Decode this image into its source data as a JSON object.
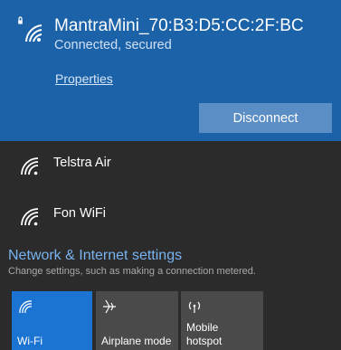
{
  "connected": {
    "name": "MantraMini_70:B3:D5:CC:2F:BC",
    "status": "Connected, secured",
    "properties_label": "Properties",
    "disconnect_label": "Disconnect"
  },
  "networks": [
    {
      "name": "Telstra Air",
      "icon": "wifi-icon"
    },
    {
      "name": "Fon WiFi",
      "icon": "wifi-icon"
    }
  ],
  "settings": {
    "title": "Network & Internet settings",
    "subtitle": "Change settings, such as making a connection metered."
  },
  "quick_actions": {
    "wifi_label": "Wi-Fi",
    "airplane_label": "Airplane mode",
    "hotspot_label_line1": "Mobile",
    "hotspot_label_line2": "hotspot"
  },
  "colors": {
    "accent": "#1b62a8",
    "link": "#79b4f1",
    "tile_active": "#1b73d2",
    "tile_inactive": "#4a4a4a",
    "background": "#2b2b2b"
  }
}
